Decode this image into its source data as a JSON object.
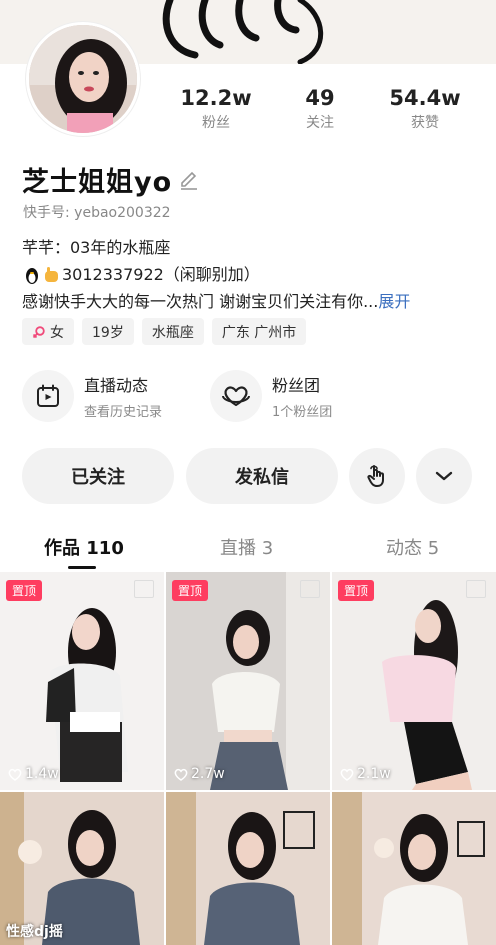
{
  "profile": {
    "name": "芝士姐姐yo",
    "uid": "快手号: yebao200322"
  },
  "stats": [
    {
      "value": "12.2w",
      "label": "粉丝"
    },
    {
      "value": "49",
      "label": "关注"
    },
    {
      "value": "54.4w",
      "label": "获赞"
    }
  ],
  "bio": {
    "line1": "芊芊：03年的水瓶座",
    "line2": "3012337922（闲聊别加）",
    "line3": "感谢快手大大的每一次热门 谢谢宝贝们关注有你...",
    "more": "展开"
  },
  "tags": [
    {
      "label": "女",
      "icon": "female-icon"
    },
    {
      "label": "19岁"
    },
    {
      "label": "水瓶座"
    },
    {
      "label": "广东 广州市"
    }
  ],
  "features": [
    {
      "title": "直播动态",
      "subtitle": "查看历史记录",
      "icon": "calendar-play-icon"
    },
    {
      "title": "粉丝团",
      "subtitle": "1个粉丝团",
      "icon": "heart-ring-icon"
    }
  ],
  "actions": {
    "followed": "已关注",
    "message": "发私信"
  },
  "tabs": [
    {
      "label": "作品 110"
    },
    {
      "label": "直播 3"
    },
    {
      "label": "动态 5"
    }
  ],
  "posts": [
    {
      "pinned": "置顶",
      "likes": "1.4w"
    },
    {
      "pinned": "置顶",
      "likes": "2.7w"
    },
    {
      "pinned": "置顶",
      "likes": "2.1w"
    },
    {
      "caption": "性感dj摇"
    },
    {},
    {}
  ],
  "colors": {
    "accent_pin": "#fe3d60",
    "link": "#3b6fbf"
  }
}
